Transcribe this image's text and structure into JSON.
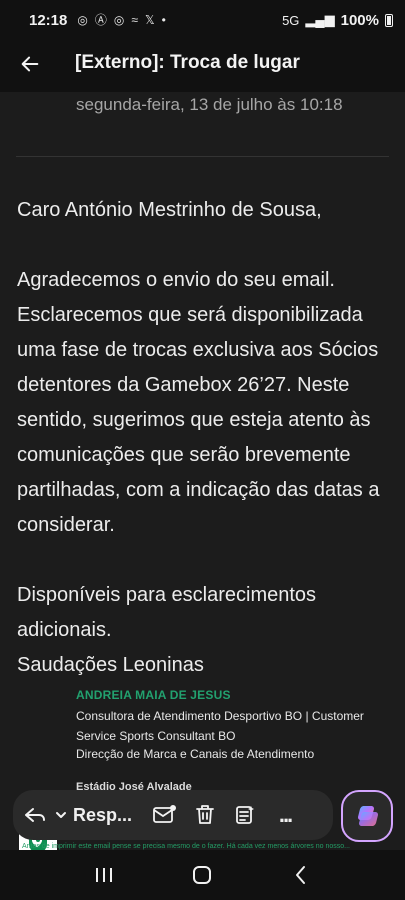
{
  "status_bar": {
    "time": "12:18",
    "battery": "100%",
    "network": "5G"
  },
  "header": {
    "title": "[Externo]: Troca de lugar"
  },
  "message": {
    "date": "segunda-feira, 13 de julho às 10:18",
    "greeting": "Caro António Mestrinho de Sousa,",
    "paragraph": "Agradecemos o envio do seu email. Esclarecemos que será disponibilizada uma fase de trocas exclusiva aos Sócios detentores da Gamebox 26’27. Neste sentido, sugerimos que esteja atento às comunicações que serão brevemente partilhadas, com a indicação das datas a considerar.",
    "closing": "Disponíveis para esclarecimentos adicionais.",
    "signoff": "Saudações Leoninas"
  },
  "signature": {
    "name": "ANDREIA MAIA DE JESUS",
    "role": "Consultora de Atendimento Desportivo BO | Customer Service Sports Consultant BO",
    "department": "Direcção de Marca e Canais de Atendimento",
    "place": "Estádio José Alvalade"
  },
  "toolbar": {
    "reply_label": "Resp...",
    "more_label": "..."
  },
  "warning": {
    "text": "Antes de imprimir este email pense se precisa mesmo de o fazer. Há cada vez menos árvores no nosso..."
  },
  "colors": {
    "accent": "#22a16f",
    "background": "#111111",
    "content_bg": "#1c1c1c"
  }
}
